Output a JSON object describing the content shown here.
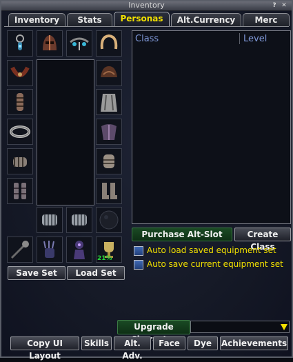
{
  "window": {
    "title": "Inventory",
    "help_glyph": "?",
    "close_glyph": "✕"
  },
  "tabs": [
    {
      "label": "Inventory",
      "active": false
    },
    {
      "label": "Stats",
      "active": false
    },
    {
      "label": "Personas",
      "active": true
    },
    {
      "label": "Alt.Currency",
      "active": false
    },
    {
      "label": "Merc",
      "active": false
    }
  ],
  "equipment": {
    "charm_percent": "21%"
  },
  "buttons": {
    "save_set": "Save Set",
    "load_set": "Load Set",
    "purchase_alt_slot": "Purchase Alt-Slot",
    "create_class": "Create Class",
    "upgrade_character": "Upgrade Character"
  },
  "class_list": {
    "col_class": "Class",
    "col_level": "Level"
  },
  "options": {
    "auto_load": "Auto load saved equipment set",
    "auto_save": "Auto save current equipment set"
  },
  "bottom_bar": {
    "copy_ui_layout": "Copy UI Layout",
    "skills": "Skills",
    "alt_adv": "Alt. Adv.",
    "face": "Face",
    "dye": "Dye",
    "achievements": "Achievements"
  },
  "colors": {
    "accent_yellow": "#f2e000",
    "header_blue": "#7f98d8",
    "percent_green": "#27d23a"
  }
}
